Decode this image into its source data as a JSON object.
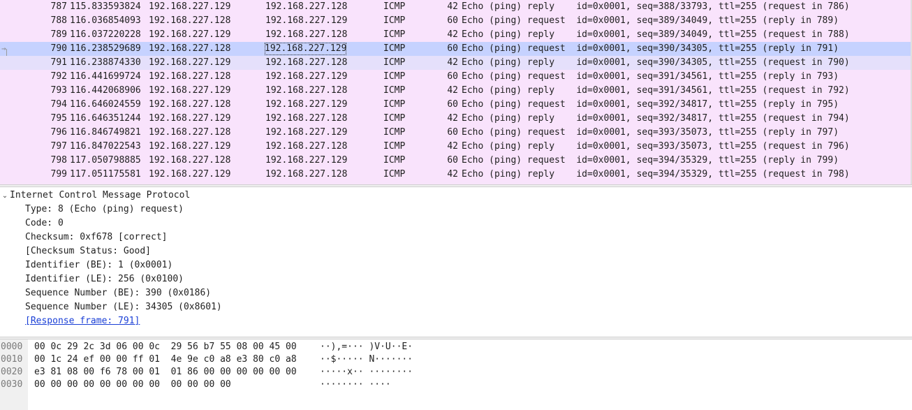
{
  "packet_list": {
    "rows": [
      {
        "no": "787",
        "time": "115.833593824",
        "src": "192.168.227.129",
        "dst": "192.168.227.128",
        "proto": "ICMP",
        "len": "42",
        "info": "Echo (ping) reply    id=0x0001, seq=388/33793, ttl=255 (request in 786)",
        "state": "normal"
      },
      {
        "no": "788",
        "time": "116.036854093",
        "src": "192.168.227.128",
        "dst": "192.168.227.129",
        "proto": "ICMP",
        "len": "60",
        "info": "Echo (ping) request  id=0x0001, seq=389/34049, ttl=255 (reply in 789)",
        "state": "normal"
      },
      {
        "no": "789",
        "time": "116.037220228",
        "src": "192.168.227.129",
        "dst": "192.168.227.128",
        "proto": "ICMP",
        "len": "42",
        "info": "Echo (ping) reply    id=0x0001, seq=389/34049, ttl=255 (request in 788)",
        "state": "normal"
      },
      {
        "no": "790",
        "time": "116.238529689",
        "src": "192.168.227.128",
        "dst": "192.168.227.129",
        "proto": "ICMP",
        "len": "60",
        "info": "Echo (ping) request  id=0x0001, seq=390/34305, ttl=255 (reply in 791)",
        "state": "selected"
      },
      {
        "no": "791",
        "time": "116.238874330",
        "src": "192.168.227.129",
        "dst": "192.168.227.128",
        "proto": "ICMP",
        "len": "42",
        "info": "Echo (ping) reply    id=0x0001, seq=390/34305, ttl=255 (request in 790)",
        "state": "related"
      },
      {
        "no": "792",
        "time": "116.441699724",
        "src": "192.168.227.128",
        "dst": "192.168.227.129",
        "proto": "ICMP",
        "len": "60",
        "info": "Echo (ping) request  id=0x0001, seq=391/34561, ttl=255 (reply in 793)",
        "state": "normal"
      },
      {
        "no": "793",
        "time": "116.442068906",
        "src": "192.168.227.129",
        "dst": "192.168.227.128",
        "proto": "ICMP",
        "len": "42",
        "info": "Echo (ping) reply    id=0x0001, seq=391/34561, ttl=255 (request in 792)",
        "state": "normal"
      },
      {
        "no": "794",
        "time": "116.646024559",
        "src": "192.168.227.128",
        "dst": "192.168.227.129",
        "proto": "ICMP",
        "len": "60",
        "info": "Echo (ping) request  id=0x0001, seq=392/34817, ttl=255 (reply in 795)",
        "state": "normal"
      },
      {
        "no": "795",
        "time": "116.646351244",
        "src": "192.168.227.129",
        "dst": "192.168.227.128",
        "proto": "ICMP",
        "len": "42",
        "info": "Echo (ping) reply    id=0x0001, seq=392/34817, ttl=255 (request in 794)",
        "state": "normal"
      },
      {
        "no": "796",
        "time": "116.846749821",
        "src": "192.168.227.128",
        "dst": "192.168.227.129",
        "proto": "ICMP",
        "len": "60",
        "info": "Echo (ping) request  id=0x0001, seq=393/35073, ttl=255 (reply in 797)",
        "state": "normal"
      },
      {
        "no": "797",
        "time": "116.847022543",
        "src": "192.168.227.129",
        "dst": "192.168.227.128",
        "proto": "ICMP",
        "len": "42",
        "info": "Echo (ping) reply    id=0x0001, seq=393/35073, ttl=255 (request in 796)",
        "state": "normal"
      },
      {
        "no": "798",
        "time": "117.050798885",
        "src": "192.168.227.128",
        "dst": "192.168.227.129",
        "proto": "ICMP",
        "len": "60",
        "info": "Echo (ping) request  id=0x0001, seq=394/35329, ttl=255 (reply in 799)",
        "state": "normal"
      },
      {
        "no": "799",
        "time": "117.051175581",
        "src": "192.168.227.129",
        "dst": "192.168.227.128",
        "proto": "ICMP",
        "len": "42",
        "info": "Echo (ping) reply    id=0x0001, seq=394/35329, ttl=255 (request in 798)",
        "state": "normal"
      }
    ]
  },
  "details": {
    "header": "Internet Control Message Protocol",
    "expand_icon": "chevron-down-icon",
    "fields": [
      "Type: 8 (Echo (ping) request)",
      "Code: 0",
      "Checksum: 0xf678 [correct]",
      "[Checksum Status: Good]",
      "Identifier (BE): 1 (0x0001)",
      "Identifier (LE): 256 (0x0100)",
      "Sequence Number (BE): 390 (0x0186)",
      "Sequence Number (LE): 34305 (0x8601)"
    ],
    "link": "[Response frame: 791]"
  },
  "bytes": {
    "rows": [
      {
        "offset": "0000",
        "hex": "00 0c 29 2c 3d 06 00 0c  29 56 b7 55 08 00 45 00",
        "ascii": "··),=··· )V·U··E·"
      },
      {
        "offset": "0010",
        "hex": "00 1c 24 ef 00 00 ff 01  4e 9e c0 a8 e3 80 c0 a8",
        "ascii": "··$····· N·······"
      },
      {
        "offset": "0020",
        "hex": "e3 81 08 00 f6 78 00 01  01 86 00 00 00 00 00 00",
        "ascii": "·····x·· ········"
      },
      {
        "offset": "0030",
        "hex": "00 00 00 00 00 00 00 00  00 00 00 00",
        "ascii": "········ ····"
      }
    ]
  },
  "colors": {
    "row_bg": "#f9e3fc",
    "selected_bg": "#c6d2ff",
    "related_bg": "#e5e0fb",
    "link": "#1a3fd6"
  }
}
